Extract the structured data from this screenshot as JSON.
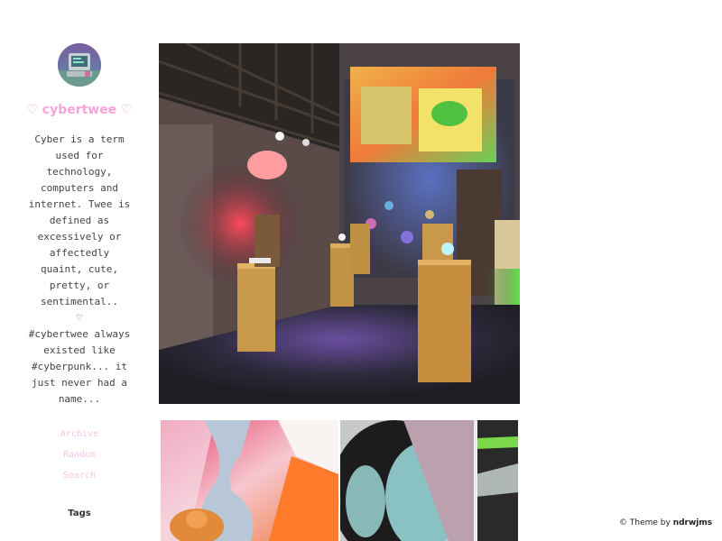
{
  "blog": {
    "title": "♡ cybertwee ♡",
    "description": "Cyber is a term\nused for\ntechnology,\ncomputers and\ninternet. Twee is\ndefined as\nexcessively or\naffectedly\nquaint, cute,\npretty, or\nsentimental..\n♡\n#cybertwee always\nexisted like\n#cyberpunk... it\njust never had a\nname..."
  },
  "nav": {
    "archive": "Archive",
    "random": "Random",
    "search": "Search"
  },
  "tags": {
    "heading": "Tags"
  },
  "footer": {
    "copyright": "© Theme",
    "by": "by",
    "author": "ndrwjms"
  },
  "colors": {
    "accent": "#f6a3dc",
    "nav_link": "#f9c4e8",
    "text": "#444444"
  },
  "icons": {
    "avatar": "retro-computer-avatar"
  }
}
